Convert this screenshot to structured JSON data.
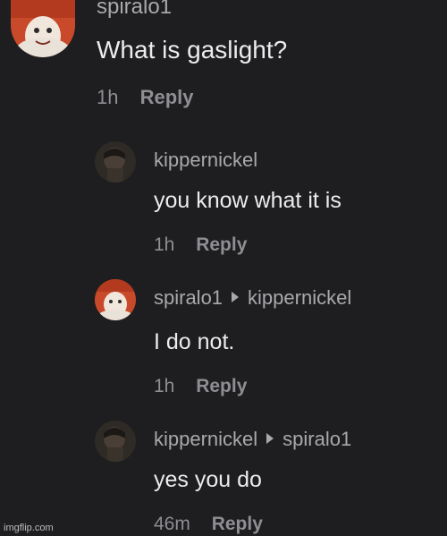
{
  "comments": [
    {
      "username": "spiralo1",
      "text": "What is gaslight?",
      "time": "1h",
      "reply_label": "Reply"
    },
    {
      "username": "kippernickel",
      "text": "you know what it is",
      "time": "1h",
      "reply_label": "Reply"
    },
    {
      "username": "spiralo1",
      "reply_to": "kippernickel",
      "text": "I do not.",
      "time": "1h",
      "reply_label": "Reply"
    },
    {
      "username": "kippernickel",
      "reply_to": "spiralo1",
      "text": "yes you do",
      "time": "46m",
      "reply_label": "Reply"
    }
  ],
  "watermark": "imgflip.com",
  "colors": {
    "background": "#1e1e20",
    "username": "#a9a9ad",
    "body_text": "#ececee",
    "meta": "#8e8e93"
  },
  "icons": {
    "reply_to_separator": "triangle-right-icon"
  }
}
